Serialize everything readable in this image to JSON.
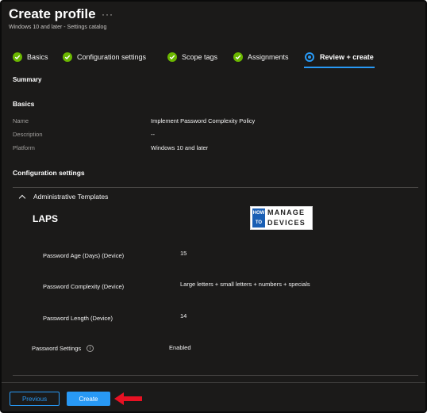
{
  "header": {
    "title": "Create profile",
    "more": "···",
    "subtitle": "Windows 10 and later - Settings catalog"
  },
  "steps": [
    {
      "label": "Basics",
      "state": "done"
    },
    {
      "label": "Configuration settings",
      "state": "done"
    },
    {
      "label": "Scope tags",
      "state": "done"
    },
    {
      "label": "Assignments",
      "state": "done"
    },
    {
      "label": "Review + create",
      "state": "active"
    }
  ],
  "summary": {
    "title": "Summary"
  },
  "basics": {
    "title": "Basics",
    "rows": [
      {
        "label": "Name",
        "value": "Implement Password Complexity Policy"
      },
      {
        "label": "Description",
        "value": "--"
      },
      {
        "label": "Platform",
        "value": "Windows 10 and later"
      }
    ]
  },
  "config": {
    "title": "Configuration settings",
    "group": "Administrative Templates",
    "category": "LAPS",
    "rows": [
      {
        "label": "Password Age (Days) (Device)",
        "value": "15"
      },
      {
        "label": "Password Complexity (Device)",
        "value": "Large letters + small letters + numbers + specials"
      },
      {
        "label": "Password Length (Device)",
        "value": "14"
      }
    ],
    "password_settings": {
      "label": "Password Settings",
      "value": "Enabled",
      "info_icon": "info-icon"
    }
  },
  "logo": {
    "how": "HOW",
    "to": "TO",
    "line1": "MANAGE",
    "line2": "DEVICES"
  },
  "footer": {
    "previous": "Previous",
    "create": "Create"
  },
  "colors": {
    "accent": "#2899f5",
    "success": "#6bb700",
    "background": "#1b1a19",
    "arrow": "#e81123"
  }
}
